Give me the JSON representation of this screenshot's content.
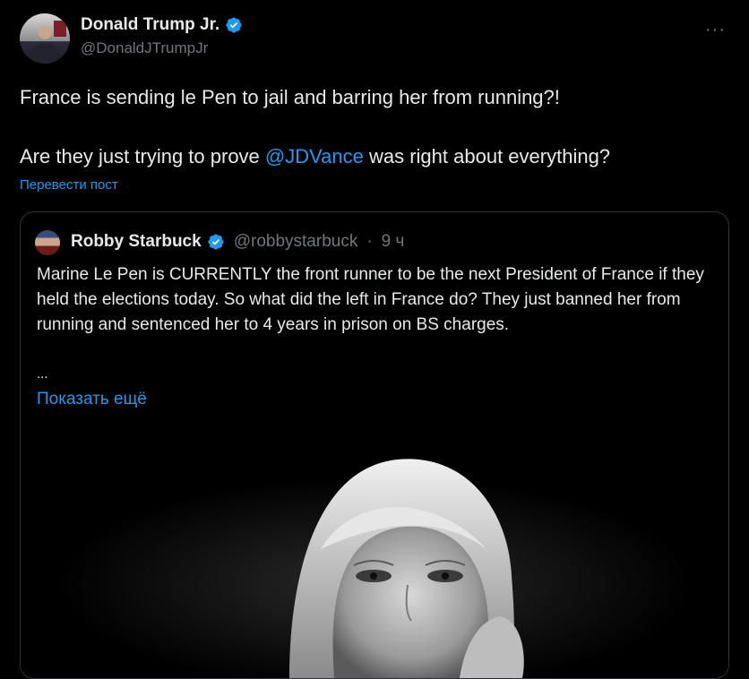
{
  "tweet": {
    "author_name": "Donald Trump Jr.",
    "author_handle": "@DonaldJTrumpJr",
    "more_glyph": "···",
    "line1": "France is sending le Pen to jail and barring her from running?!",
    "line2_before": "Are they just trying to prove ",
    "line2_mention": "@JDVance",
    "line2_after": " was right about everything?",
    "translate_label": "Перевести пост"
  },
  "quote": {
    "author_name": "Robby Starbuck",
    "author_handle": "@robbystarbuck",
    "separator": "·",
    "time": "9 ч",
    "text": "Marine Le Pen is CURRENTLY the front runner to be the next President of France if they held the elections today. So what did the left in France do? They just banned her from running and sentenced her to 4 years in prison on BS charges.",
    "ellipsis": "...",
    "show_more_label": "Показать ещё"
  },
  "colors": {
    "background": "#000000",
    "text": "#e7e9ea",
    "muted": "#71767b",
    "link": "#1d9bf0",
    "border": "#2f3336"
  },
  "icons": [
    "verified-badge-icon",
    "more-options-icon"
  ]
}
